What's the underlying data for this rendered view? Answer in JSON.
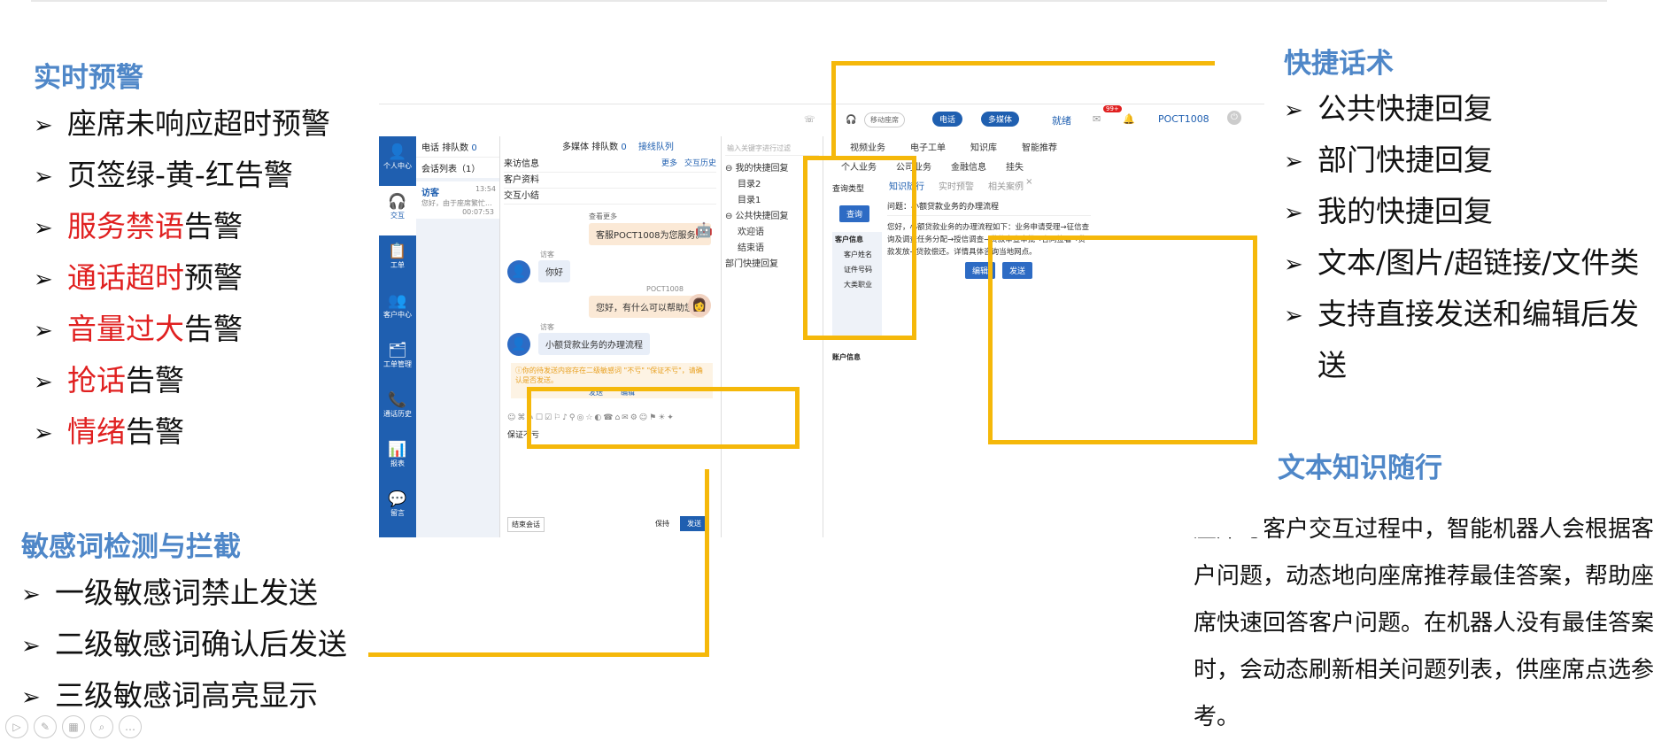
{
  "left": {
    "title": "实时预警",
    "items": [
      {
        "pre": "",
        "red": "",
        "post": "座席未响应超时预警"
      },
      {
        "pre": "",
        "red": "",
        "post": "页签绿-黄-红告警"
      },
      {
        "pre": "",
        "red": "服务禁语",
        "post": "告警"
      },
      {
        "pre": "",
        "red": "通话超时",
        "post": "预警"
      },
      {
        "pre": "",
        "red": "音量过大",
        "post": "告警"
      },
      {
        "pre": "",
        "red": "抢话",
        "post": "告警"
      },
      {
        "pre": "",
        "red": "情绪",
        "post": "告警"
      }
    ]
  },
  "sensitive": {
    "title": "敏感词检测与拦截",
    "items": [
      "一级敏感词禁止发送",
      "二级敏感词确认后发送",
      "三级敏感词高亮显示"
    ]
  },
  "quick": {
    "title": "快捷话术",
    "items": [
      "公共快捷回复",
      "部门快捷回复",
      "我的快捷回复",
      "文本/图片/超链接/文件类",
      "支持直接发送和编辑后发",
      "送"
    ]
  },
  "knowledge": {
    "title": "文本知识随行",
    "paragraph": "座席与客户交互过程中，智能机器人会根据客户问题，动态地向座席推荐最佳答案，帮助座席快速回答客户问题。在机器人没有最佳答案时，会动态刷新相关问题列表，供座席点选参考。"
  },
  "arrow": "➢",
  "app": {
    "topbar": {
      "mobile": "移动座席",
      "phone": "电话",
      "media": "多媒体",
      "status": "就绪",
      "badge": "99+",
      "user": "POCT1008"
    },
    "nav": [
      "个人中心",
      "交互",
      "工单",
      "客户中心",
      "工单管理",
      "通话历史",
      "报表",
      "留言"
    ],
    "queue": {
      "phone": "电话",
      "queue_label": "排队数",
      "phone_count": "0",
      "media": "多媒体",
      "media_count": "0",
      "link": "接线队列"
    },
    "session": {
      "header": "会话列表（1）",
      "name": "访客",
      "time": "13:54",
      "preview": "您好，由于座席繁忙...",
      "duration": "00:07:53"
    },
    "visitor": {
      "title": "来访信息",
      "more": "更多",
      "history": "交互历史",
      "profile": "客户资料",
      "summary": "交互小结"
    },
    "chat": {
      "see_more": "查看更多",
      "m1": "客服POCT1008为您服务。",
      "v1_label": "访客",
      "v1": "你好",
      "a_label": "POCT1008",
      "a1": "您好，有什么可以帮助您?",
      "v2_label": "访客",
      "v2": "小额贷款业务的办理流程",
      "warn": "ⓘ你的待发送内容存在二级敏感词 \"不亏\" \"保证不亏\"，请确认是否发送。",
      "send": "发送",
      "edit": "编辑",
      "input": "保证不亏",
      "end": "结束会话",
      "hold": "保持",
      "send_btn": "发送"
    },
    "quick_panel": {
      "placeholder": "输入关键字进行过滤",
      "tree": [
        "我的快捷回复",
        "目录2",
        "目录1",
        "公共快捷回复",
        "欢迎语",
        "结束语",
        "部门快捷回复"
      ]
    },
    "right": {
      "tabs1": [
        "视频业务",
        "电子工单",
        "知识库",
        "智能推荐"
      ],
      "tabs2": [
        "个人业务",
        "公司业务",
        "金融信息",
        "挂失"
      ],
      "query_type": "查询类型",
      "query_btn": "查询",
      "cust_info": "客户信息",
      "cust_name": "客户姓名",
      "cert": "证件号码",
      "job": "大类职业",
      "acct": "账户信息",
      "ktabs": [
        "知识随行",
        "实时预警",
        "相关案例"
      ],
      "question": "问题：小额贷款业务的办理流程",
      "answer": "您好，小额贷款业务的办理流程如下：业务申请受理→征信查询及调查任务分配→授信调查→贷款审查审批→合同签署→贷款发放→贷款偿还。详情具体咨询当地网点。",
      "edit": "编辑",
      "send": "发送"
    }
  },
  "colors": {
    "accent": "#4f87c8",
    "highlight": "#f5b80a",
    "alert": "#e02020",
    "nav": "#1f5fb0"
  }
}
